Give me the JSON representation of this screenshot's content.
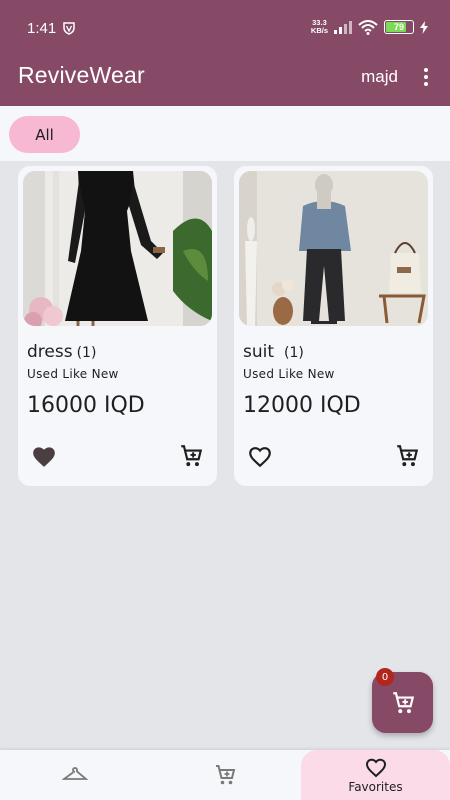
{
  "status_bar": {
    "time": "1:41",
    "net_speed_value": "33.3",
    "net_speed_unit": "KB/s",
    "battery": "79",
    "battery_level": 0.79
  },
  "app_bar": {
    "title": "ReviveWear",
    "user": "majd",
    "menu_icon": "more-vert-icon"
  },
  "filters": {
    "chips": [
      {
        "label": "All",
        "selected": true
      }
    ]
  },
  "products": [
    {
      "name": "dress",
      "quantity": "(1)",
      "condition": "Used Like New",
      "price": "16000 IQD",
      "favorited": true,
      "fav_icon": "heart-filled-icon",
      "cart_icon": "add-to-cart-icon"
    },
    {
      "name": "suit",
      "quantity": "(1)",
      "condition": "Used Like New",
      "price": "12000 IQD",
      "favorited": false,
      "fav_icon": "heart-outline-icon",
      "cart_icon": "add-to-cart-icon"
    }
  ],
  "cart_fab": {
    "count": "0",
    "icon": "cart-icon"
  },
  "bottom_nav": {
    "items": [
      {
        "icon": "hanger-icon",
        "label": "",
        "active": false
      },
      {
        "icon": "cart-icon",
        "label": "",
        "active": false
      },
      {
        "icon": "heart-outline-icon",
        "label": "Favorites",
        "active": true
      }
    ]
  },
  "colors": {
    "primary": "#864a67",
    "chip": "#f7b8d3",
    "nav_active": "#fadbe7",
    "background": "#e4e5e9",
    "surface": "#f6f7fb",
    "badge": "#b3261e"
  }
}
